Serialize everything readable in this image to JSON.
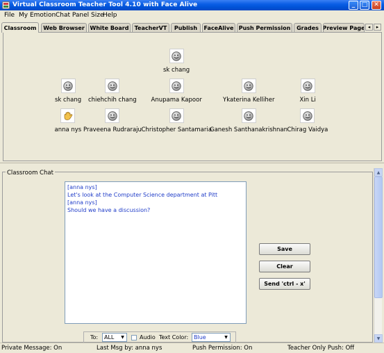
{
  "window": {
    "title": "Virtual Classroom Teacher Tool 4.10 with Face Alive",
    "minimize_glyph": "_",
    "maximize_glyph": "□",
    "close_glyph": "✕"
  },
  "menu": [
    "File",
    "My Emotion",
    "Chat Panel Size",
    "Help"
  ],
  "tabs": [
    "Classroom",
    "Web Browser",
    "White Board",
    "TeacherVT",
    "Publish",
    "FaceAlive",
    "Push Permission",
    "Grades",
    "Preview Page"
  ],
  "tab_scroll": {
    "left_glyph": "◂",
    "right_glyph": "▸"
  },
  "classroom": {
    "students": [
      {
        "name": "sk chang",
        "icon": "smiley-face-icon"
      },
      {
        "name": "sk chang",
        "icon": "smiley-face-icon"
      },
      {
        "name": "chiehchih chang",
        "icon": "smiley-face-icon"
      },
      {
        "name": "Anupama Kapoor",
        "icon": "smiley-face-icon"
      },
      {
        "name": "Ykaterina Kelliher",
        "icon": "smiley-face-icon"
      },
      {
        "name": "Xin Li",
        "icon": "smiley-face-icon"
      },
      {
        "name": "anna nys",
        "icon": "raised-hand-icon"
      },
      {
        "name": "Praveena Rudraraju",
        "icon": "smiley-face-icon"
      },
      {
        "name": "Christopher Santamaria",
        "icon": "smiley-face-icon"
      },
      {
        "name": "Ganesh Santhanakrishnan",
        "icon": "smiley-face-icon"
      },
      {
        "name": "Chirag Vaidya",
        "icon": "smiley-face-icon"
      }
    ]
  },
  "chat": {
    "title": "Classroom Chat",
    "messages": [
      "[anna nys]",
      "Let's look at the Computer Science department at Pitt",
      "[anna nys]",
      "Should we have a discussion?"
    ],
    "buttons": {
      "save": "Save",
      "clear": "Clear",
      "send": "Send 'ctrl - x'"
    },
    "controls": {
      "to_label": "To:",
      "to_value": "ALL",
      "audio_label": "Audio",
      "text_color_label": "Text Color:",
      "text_color_value": "Blue",
      "text_color_hex": "#1f3cc8"
    }
  },
  "status": {
    "private_message": "Private Message: On",
    "last_msg": "Last Msg by: anna nys",
    "push_permission": "Push Permission: On",
    "teacher_only_push": "Teacher Only Push: Off"
  },
  "colors": {
    "titlebar": "#0a5ee5",
    "chat_text": "#1f3cc8",
    "window_bg": "#ece9d8",
    "scrollbar": "#c7d5f4"
  }
}
